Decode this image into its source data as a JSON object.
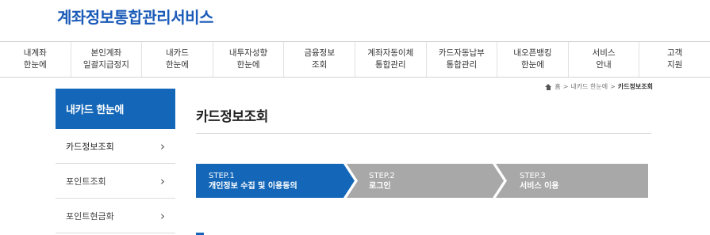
{
  "brand": "계좌정보통합관리서비스",
  "gnb": [
    {
      "l1": "내계좌",
      "l2": "한눈에"
    },
    {
      "l1": "본인계좌",
      "l2": "일괄지급정지"
    },
    {
      "l1": "내카드",
      "l2": "한눈에"
    },
    {
      "l1": "내투자성향",
      "l2": "한눈에"
    },
    {
      "l1": "금융정보",
      "l2": "조회"
    },
    {
      "l1": "계좌자동이체",
      "l2": "통합관리"
    },
    {
      "l1": "카드자동납부",
      "l2": "통합관리"
    },
    {
      "l1": "내오픈뱅킹",
      "l2": "한눈에"
    },
    {
      "l1": "서비스",
      "l2": "안내"
    },
    {
      "l1": "고객",
      "l2": "지원"
    }
  ],
  "sidebar": {
    "title": "내카드 한눈에",
    "items": [
      {
        "label": "카드정보조회",
        "chevron": "›"
      },
      {
        "label": "포인트조회",
        "chevron": "›"
      },
      {
        "label": "포인트현금화",
        "chevron": "›"
      }
    ]
  },
  "breadcrumb": {
    "home": "홈",
    "sep": ">",
    "parent": "내카드 한눈에",
    "current": "카드정보조회"
  },
  "page_title": "카드정보조회",
  "steps": [
    {
      "num": "STEP.1",
      "label": "개인정보 수집 및 이용동의"
    },
    {
      "num": "STEP.2",
      "label": "로그인"
    },
    {
      "num": "STEP.3",
      "label": "서비스 이용"
    }
  ],
  "colors": {
    "accent": "#1467b8",
    "inactive_step": "#a8a8a8",
    "brand": "#1a5ab8"
  },
  "icons": {
    "home": "home-icon",
    "chevron": "chevron-right-icon"
  }
}
